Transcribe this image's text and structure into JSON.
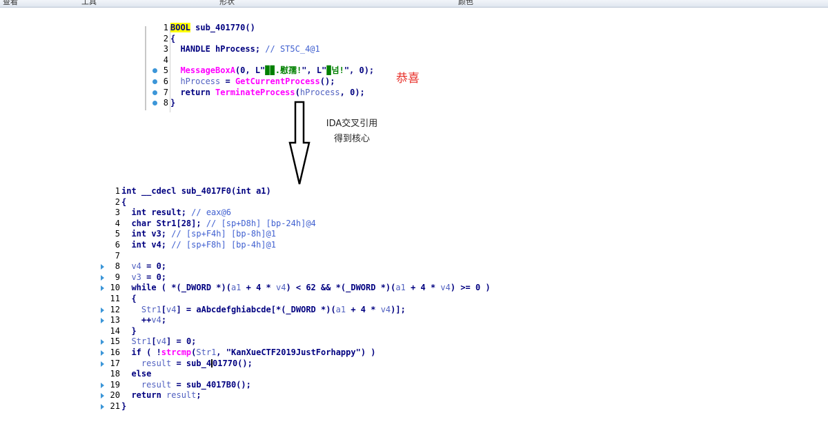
{
  "menu": [
    "查看",
    "工具",
    "形状",
    "颜色"
  ],
  "annotation": {
    "line1": "IDA交叉引用",
    "line2": "得到核心",
    "congrats": "恭喜"
  },
  "colors": {
    "marker": "#3c96d8",
    "keyword": "#000080",
    "function": "#ff00ff",
    "comment": "#4060d0",
    "string": "#008000",
    "annotation": "#e8302a"
  },
  "code_top": [
    {
      "n": "1",
      "tokens": [
        [
          "hl kw",
          "BOOL"
        ],
        [
          "kw",
          " sub_401770()"
        ]
      ]
    },
    {
      "n": "2",
      "tokens": [
        [
          "kw",
          "{"
        ]
      ]
    },
    {
      "n": "3",
      "tokens": [
        [
          "kw",
          "  HANDLE hProcess; "
        ],
        [
          "cm",
          "// ST5C_4@1"
        ]
      ]
    },
    {
      "n": "4",
      "tokens": []
    },
    {
      "n": "5",
      "dot": true,
      "tokens": [
        [
          "fn",
          "  MessageBoxA"
        ],
        [
          "kw",
          "(0, L\""
        ],
        [
          "st",
          "▉▉.慰孺!"
        ],
        [
          "kw",
          "\", L\""
        ],
        [
          "st",
          "▉넘!"
        ],
        [
          "kw",
          "\", 0);"
        ]
      ]
    },
    {
      "n": "6",
      "dot": true,
      "tokens": [
        [
          "vr",
          "  hProcess"
        ],
        [
          "kw",
          " = "
        ],
        [
          "fn",
          "GetCurrentProcess"
        ],
        [
          "kw",
          "();"
        ]
      ]
    },
    {
      "n": "7",
      "dot": true,
      "tokens": [
        [
          "kw",
          "  return "
        ],
        [
          "fn",
          "TerminateProcess"
        ],
        [
          "kw",
          "("
        ],
        [
          "vr",
          "hProcess"
        ],
        [
          "kw",
          ", 0);"
        ]
      ]
    },
    {
      "n": "8",
      "dot": true,
      "tokens": [
        [
          "kw",
          "}"
        ]
      ]
    }
  ],
  "code_bottom": [
    {
      "n": "1",
      "tokens": [
        [
          "kw",
          "int __cdecl sub_4017F0(int a1)"
        ]
      ]
    },
    {
      "n": "2",
      "tokens": [
        [
          "kw",
          "{"
        ]
      ]
    },
    {
      "n": "3",
      "tokens": [
        [
          "kw",
          "  int result; "
        ],
        [
          "cm",
          "// eax@6"
        ]
      ]
    },
    {
      "n": "4",
      "tokens": [
        [
          "kw",
          "  char Str1[28]; "
        ],
        [
          "cm",
          "// [sp+D8h] [bp-24h]@4"
        ]
      ]
    },
    {
      "n": "5",
      "tokens": [
        [
          "kw",
          "  int v3; "
        ],
        [
          "cm",
          "// [sp+F4h] [bp-8h]@1"
        ]
      ]
    },
    {
      "n": "6",
      "tokens": [
        [
          "kw",
          "  int v4; "
        ],
        [
          "cm",
          "// [sp+F8h] [bp-4h]@1"
        ]
      ]
    },
    {
      "n": "7",
      "tokens": []
    },
    {
      "n": "8",
      "tri": true,
      "tokens": [
        [
          "vr",
          "  v4"
        ],
        [
          "kw",
          " = 0;"
        ]
      ]
    },
    {
      "n": "9",
      "tri": true,
      "tokens": [
        [
          "vr",
          "  v3"
        ],
        [
          "kw",
          " = 0;"
        ]
      ]
    },
    {
      "n": "10",
      "tri": true,
      "tokens": [
        [
          "kw",
          "  while ( *(_DWORD *)("
        ],
        [
          "vr",
          "a1"
        ],
        [
          "kw",
          " + 4 * "
        ],
        [
          "vr",
          "v4"
        ],
        [
          "kw",
          ") < 62 && *(_DWORD *)("
        ],
        [
          "vr",
          "a1"
        ],
        [
          "kw",
          " + 4 * "
        ],
        [
          "vr",
          "v4"
        ],
        [
          "kw",
          ") >= 0 )"
        ]
      ]
    },
    {
      "n": "11",
      "tokens": [
        [
          "kw",
          "  {"
        ]
      ]
    },
    {
      "n": "12",
      "tri": true,
      "tokens": [
        [
          "vr",
          "    Str1"
        ],
        [
          "kw",
          "["
        ],
        [
          "vr",
          "v4"
        ],
        [
          "kw",
          "] = aAbcdefghiabcde[*(_DWORD *)("
        ],
        [
          "vr",
          "a1"
        ],
        [
          "kw",
          " + 4 * "
        ],
        [
          "vr",
          "v4"
        ],
        [
          "kw",
          ")];"
        ]
      ]
    },
    {
      "n": "13",
      "tri": true,
      "tokens": [
        [
          "kw",
          "    ++"
        ],
        [
          "vr",
          "v4"
        ],
        [
          "kw",
          ";"
        ]
      ]
    },
    {
      "n": "14",
      "tokens": [
        [
          "kw",
          "  }"
        ]
      ]
    },
    {
      "n": "15",
      "tri": true,
      "tokens": [
        [
          "vr",
          "  Str1"
        ],
        [
          "kw",
          "["
        ],
        [
          "vr",
          "v4"
        ],
        [
          "kw",
          "] = 0;"
        ]
      ]
    },
    {
      "n": "16",
      "tri": true,
      "tokens": [
        [
          "kw",
          "  if ( !"
        ],
        [
          "fn",
          "strcmp"
        ],
        [
          "kw",
          "("
        ],
        [
          "vr",
          "Str1"
        ],
        [
          "kw",
          ", "
        ],
        [
          "pl",
          "\"KanXueCTF2019JustForhappy\""
        ],
        [
          "kw",
          ") )"
        ]
      ]
    },
    {
      "n": "17",
      "tri": true,
      "tokens": [
        [
          "vr",
          "    result"
        ],
        [
          "kw",
          " = sub_4"
        ],
        [
          "caret",
          ""
        ],
        [
          "kw",
          "01770();"
        ]
      ]
    },
    {
      "n": "18",
      "tokens": [
        [
          "kw",
          "  else"
        ]
      ]
    },
    {
      "n": "19",
      "tri": true,
      "tokens": [
        [
          "vr",
          "    result"
        ],
        [
          "kw",
          " = sub_4017B0();"
        ]
      ]
    },
    {
      "n": "20",
      "tri": true,
      "tokens": [
        [
          "kw",
          "  return "
        ],
        [
          "vr",
          "result"
        ],
        [
          "kw",
          ";"
        ]
      ]
    },
    {
      "n": "21",
      "tri": true,
      "tokens": [
        [
          "kw",
          "}"
        ]
      ]
    }
  ]
}
